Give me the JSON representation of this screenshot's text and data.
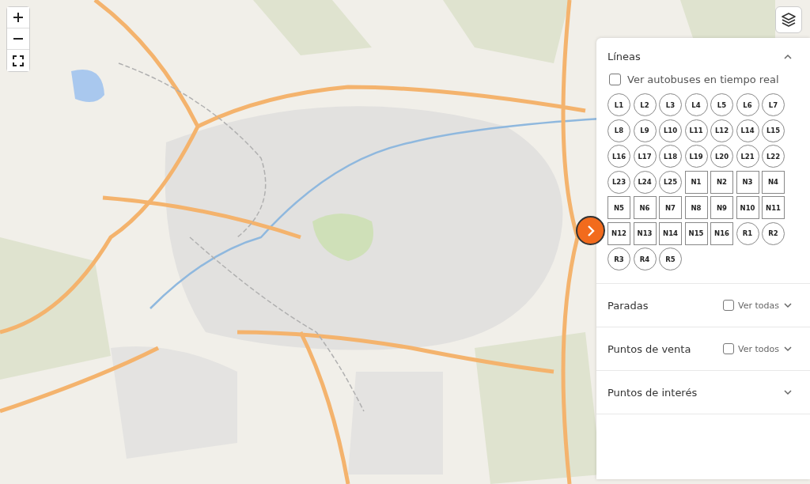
{
  "lines_panel": {
    "title": "Líneas",
    "expanded": true,
    "realtime": {
      "label": "Ver autobuses en tiempo real",
      "checked": false
    },
    "lines": [
      {
        "label": "L1",
        "kind": "round"
      },
      {
        "label": "L2",
        "kind": "round"
      },
      {
        "label": "L3",
        "kind": "round"
      },
      {
        "label": "L4",
        "kind": "round"
      },
      {
        "label": "L5",
        "kind": "round"
      },
      {
        "label": "L6",
        "kind": "round"
      },
      {
        "label": "L7",
        "kind": "round"
      },
      {
        "label": "L8",
        "kind": "round"
      },
      {
        "label": "L9",
        "kind": "round"
      },
      {
        "label": "L10",
        "kind": "round"
      },
      {
        "label": "L11",
        "kind": "round"
      },
      {
        "label": "L12",
        "kind": "round"
      },
      {
        "label": "L14",
        "kind": "round"
      },
      {
        "label": "L15",
        "kind": "round"
      },
      {
        "label": "L16",
        "kind": "round"
      },
      {
        "label": "L17",
        "kind": "round"
      },
      {
        "label": "L18",
        "kind": "round"
      },
      {
        "label": "L19",
        "kind": "round"
      },
      {
        "label": "L20",
        "kind": "round"
      },
      {
        "label": "L21",
        "kind": "round"
      },
      {
        "label": "L22",
        "kind": "round"
      },
      {
        "label": "L23",
        "kind": "round"
      },
      {
        "label": "L24",
        "kind": "round"
      },
      {
        "label": "L25",
        "kind": "round"
      },
      {
        "label": "N1",
        "kind": "square"
      },
      {
        "label": "N2",
        "kind": "square"
      },
      {
        "label": "N3",
        "kind": "square"
      },
      {
        "label": "N4",
        "kind": "square"
      },
      {
        "label": "N5",
        "kind": "square"
      },
      {
        "label": "N6",
        "kind": "square"
      },
      {
        "label": "N7",
        "kind": "square"
      },
      {
        "label": "N8",
        "kind": "square"
      },
      {
        "label": "N9",
        "kind": "square"
      },
      {
        "label": "N10",
        "kind": "square"
      },
      {
        "label": "N11",
        "kind": "square"
      },
      {
        "label": "N12",
        "kind": "square"
      },
      {
        "label": "N13",
        "kind": "square"
      },
      {
        "label": "N14",
        "kind": "square"
      },
      {
        "label": "N15",
        "kind": "square"
      },
      {
        "label": "N16",
        "kind": "square"
      },
      {
        "label": "R1",
        "kind": "round"
      },
      {
        "label": "R2",
        "kind": "round"
      },
      {
        "label": "R3",
        "kind": "round"
      },
      {
        "label": "R4",
        "kind": "round"
      },
      {
        "label": "R5",
        "kind": "round"
      }
    ]
  },
  "sections": [
    {
      "title": "Paradas",
      "expanded": false,
      "toggle": {
        "label": "Ver todas",
        "checked": false
      }
    },
    {
      "title": "Puntos de venta",
      "expanded": false,
      "toggle": {
        "label": "Ver todos",
        "checked": false
      }
    },
    {
      "title": "Puntos de interés",
      "expanded": false
    }
  ]
}
